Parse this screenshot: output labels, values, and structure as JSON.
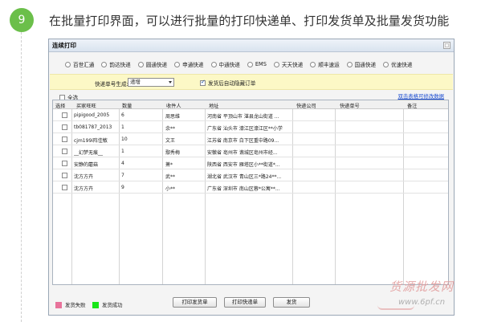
{
  "step": {
    "number": "9",
    "text": "在批量打印界面，可以进行批量的打印快递单、打印发货单及批量发货功能"
  },
  "window": {
    "title": "连续打印",
    "close_glyph": "□"
  },
  "couriers": [
    "百世汇通",
    "韵达快递",
    "圆通快递",
    "申通快递",
    "中通快递",
    "EMS",
    "天天快递",
    "顺丰速运",
    "国通快递",
    "优速快递"
  ],
  "tracking": {
    "label": "快递单号生成:",
    "selected": "递增",
    "autosplit_label": "发货后自动隐藏订单",
    "autosplit_checked": true
  },
  "select_all_label": "全选",
  "edit_link": "双击表格可修改数据",
  "grid": {
    "headers": [
      "选择",
      "买家旺旺",
      "数量",
      "收件人",
      "地址",
      "快递公司",
      "快递单号",
      "备注"
    ],
    "rows": [
      {
        "buyer": "pipigood_2005",
        "qty": "6",
        "name": "周思维",
        "addr": "河南省 平顶山市 湛县龙山街道 ..."
      },
      {
        "buyer": "tb081787_2013",
        "qty": "1",
        "name": "余**",
        "addr": "广东省 汕头市 濠江区濠江区**小学"
      },
      {
        "buyer": "cjm199i阵佳敏",
        "qty": "10",
        "name": "文王",
        "addr": "江苏省 南京市 白下区重中路09..."
      },
      {
        "buyer": "__幻梦无痕__",
        "qty": "1",
        "name": "鄢秀梅",
        "addr": "安徽省 亳州市 谯城区亳州市经..."
      },
      {
        "buyer": "安静的蘑菇",
        "qty": "4",
        "name": "萧*",
        "addr": "陕西省 西安市 雁塔区小**街道*..."
      },
      {
        "buyer": "沈方方卉",
        "qty": "7",
        "name": "武**",
        "addr": "湖北省 武汉市 青山区三*路24**..."
      },
      {
        "buyer": "沈方方卉",
        "qty": "9",
        "name": "小**",
        "addr": "广东省 深圳市 南山区蓉*公寓**..."
      }
    ]
  },
  "legend": {
    "fail_label": "发货失败",
    "fail_color": "#e8739b",
    "success_label": "发货成功",
    "success_color": "#19e619"
  },
  "buttons": {
    "print_invoice": "打印发货单",
    "print_express": "打印快递单",
    "ship": "发货"
  },
  "watermark": {
    "brand": "货源批发网",
    "url": "www.6pf.cn"
  }
}
